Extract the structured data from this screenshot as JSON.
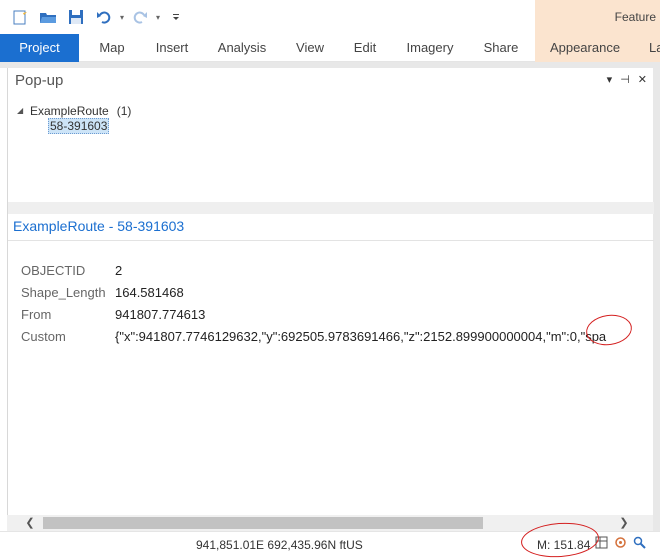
{
  "ribbon": {
    "context_group": "Feature",
    "tabs": [
      "Project",
      "Map",
      "Insert",
      "Analysis",
      "View",
      "Edit",
      "Imagery",
      "Share",
      "Appearance",
      "La"
    ]
  },
  "quick_access": {
    "icons": [
      "new-project-icon",
      "open-folder-icon",
      "save-icon",
      "undo-icon",
      "redo-icon",
      "customize-icon"
    ],
    "dropdown_glyph": "▾"
  },
  "popup": {
    "title": "Pop-up",
    "controls": [
      "▾",
      "⊣",
      "✕"
    ],
    "tree": {
      "layer_name": "ExampleRoute",
      "count": "(1)",
      "feature_id": "58-391603"
    },
    "feature_title": "ExampleRoute - 58-391603",
    "attributes": [
      {
        "key": "OBJECTID",
        "value": "2"
      },
      {
        "key": "Shape_Length",
        "value": "164.581468"
      },
      {
        "key": "From",
        "value": "941807.774613"
      },
      {
        "key": "Custom",
        "value": "{\"x\":941807.7746129632,\"y\":692505.9783691466,\"z\":2152.899900000004,\"m\":0,\"spa"
      }
    ]
  },
  "scrollbar": {
    "left_arrow": "❮",
    "right_arrow": "❯"
  },
  "status": {
    "coordinates": "941,851.01E 692,435.96N ftUS",
    "m_value": "M: 151.84"
  },
  "colors": {
    "accent": "#1b6fd0",
    "context_tab": "#fbe4cf",
    "annotation": "#d42020"
  }
}
